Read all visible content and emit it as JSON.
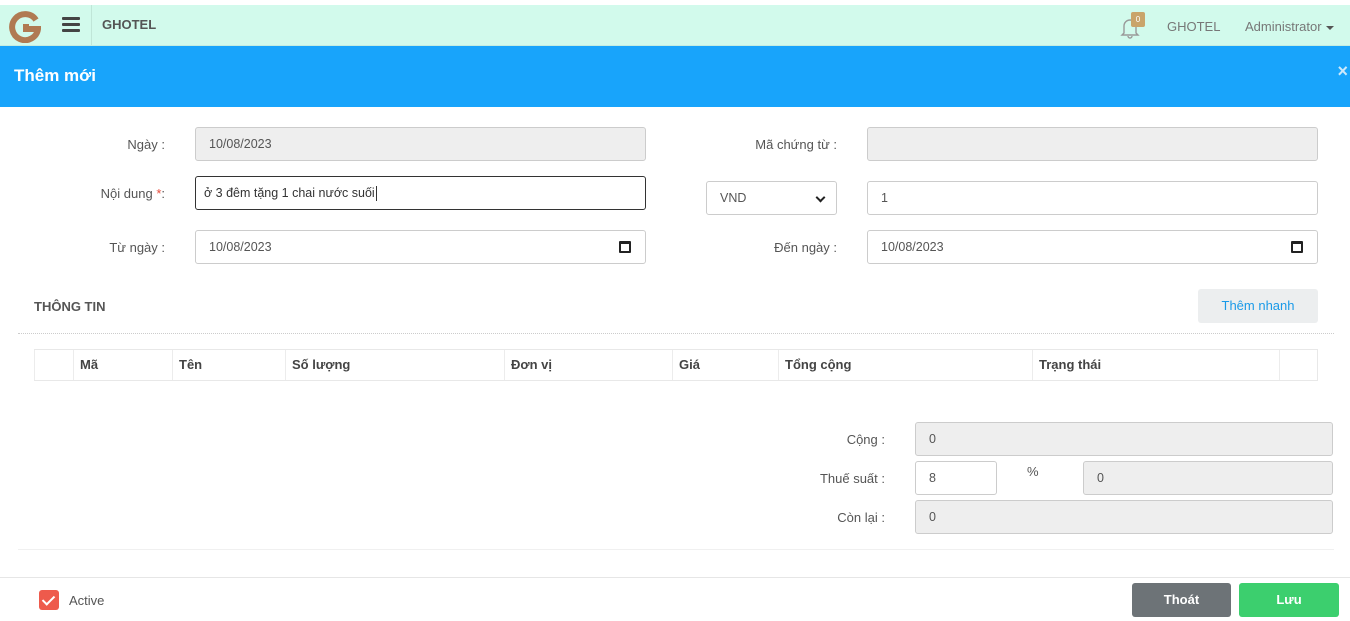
{
  "topbar": {
    "brand": "GHOTEL",
    "notification_count": "0",
    "hotel": "GHOTEL",
    "user": "Administrator"
  },
  "modal": {
    "title": "Thêm mới",
    "close_symbol": "×"
  },
  "form": {
    "date_label": "Ngày :",
    "date_value": "10/08/2023",
    "voucher_label": "Mã chứng từ :",
    "voucher_value": "",
    "content_label": "Nội dung",
    "content_required": "*",
    "content_colon": ":",
    "content_value": "ở 3 đêm tặng 1 chai nước suối",
    "currency_value": "VND",
    "rate_value": "1",
    "from_label": "Từ ngày :",
    "from_value": "10/08/2023",
    "to_label": "Đến ngày :",
    "to_value": "10/08/2023"
  },
  "section": {
    "title": "THÔNG TIN",
    "quick_add_label": "Thêm nhanh"
  },
  "table": {
    "columns": [
      "Mã",
      "Tên",
      "Số lượng",
      "Đơn vị",
      "Giá",
      "Tổng cộng",
      "Trạng thái"
    ]
  },
  "totals": {
    "sum_label": "Cộng :",
    "sum_value": "0",
    "tax_label": "Thuế suất :",
    "tax_rate": "8",
    "percent_sign": "%",
    "tax_value": "0",
    "remaining_label": "Còn lại :",
    "remaining_value": "0"
  },
  "footer": {
    "active_label": "Active",
    "exit_label": "Thoát",
    "save_label": "Lưu"
  },
  "colors": {
    "topbar_bg": "#d2faec",
    "header_bg": "#18a4fb",
    "save_bg": "#3ccf6e",
    "exit_bg": "#6d7377",
    "checkbox_bg": "#ee5a4c"
  }
}
